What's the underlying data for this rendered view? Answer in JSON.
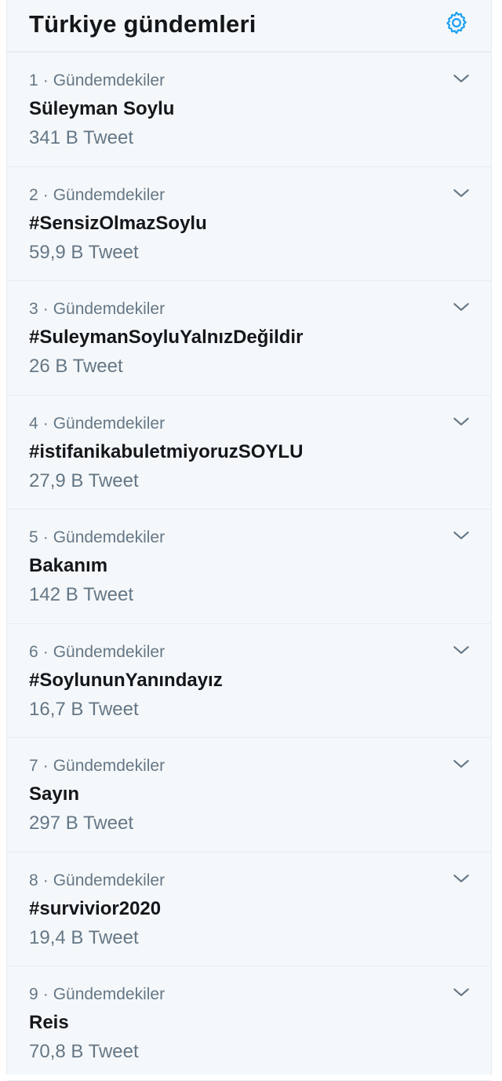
{
  "header": {
    "title": "Türkiye gündemleri",
    "settings_icon": "gear-icon",
    "accent_color": "#1da1f2"
  },
  "trend_context": "Gündemdekiler",
  "separator": "·",
  "trends": [
    {
      "rank": "1",
      "context": "Gündemdekiler",
      "name": "Süleyman Soylu",
      "count": "341 B Tweet"
    },
    {
      "rank": "2",
      "context": "Gündemdekiler",
      "name": "#SensizOlmazSoylu",
      "count": "59,9 B Tweet"
    },
    {
      "rank": "3",
      "context": "Gündemdekiler",
      "name": "#SuleymanSoyluYalnızDeğildir",
      "count": "26 B Tweet"
    },
    {
      "rank": "4",
      "context": "Gündemdekiler",
      "name": "#istifanikabuletmiyoruzSOYLU",
      "count": "27,9 B Tweet"
    },
    {
      "rank": "5",
      "context": "Gündemdekiler",
      "name": "Bakanım",
      "count": "142 B Tweet"
    },
    {
      "rank": "6",
      "context": "Gündemdekiler",
      "name": "#SoylununYanındayız",
      "count": "16,7 B Tweet"
    },
    {
      "rank": "7",
      "context": "Gündemdekiler",
      "name": "Sayın",
      "count": "297 B Tweet"
    },
    {
      "rank": "8",
      "context": "Gündemdekiler",
      "name": "#survivior2020",
      "count": "19,4 B Tweet"
    },
    {
      "rank": "9",
      "context": "Gündemdekiler",
      "name": "Reis",
      "count": "70,8 B Tweet"
    }
  ]
}
